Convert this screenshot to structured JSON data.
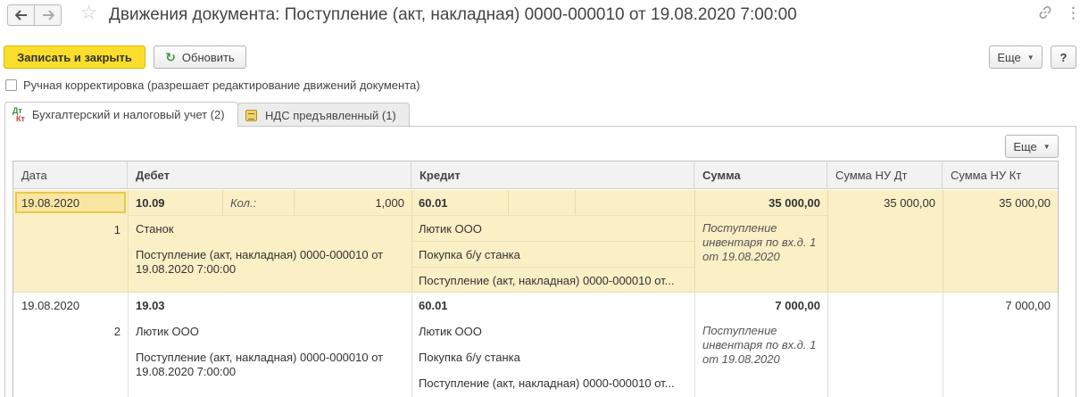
{
  "window": {
    "title": "Движения документа: Поступление (акт, накладная) 0000-000010 от 19.08.2020 7:00:00",
    "icons": [
      "arrow-left-icon",
      "arrow-right-icon",
      "star-icon",
      "link-icon",
      "more-vertical-icon"
    ]
  },
  "toolbar": {
    "save_close_label": "Записать и закрыть",
    "refresh_label": "Обновить",
    "more_label": "Еще",
    "help_label": "?"
  },
  "manual_edit": {
    "label": "Ручная корректировка (разрешает редактирование движений документа)",
    "checked": false
  },
  "tabs": [
    {
      "label": "Бухгалтерский и налоговый учет (2)",
      "icon": "dt-kt-icon",
      "icon_dt": "Дт",
      "icon_kt": "Кт",
      "active": true
    },
    {
      "label": "НДС предъявленный (1)",
      "icon": "register-icon",
      "active": false
    }
  ],
  "table": {
    "more_label": "Еще",
    "columns": [
      "Дата",
      "Дебет",
      "Кредит",
      "Сумма",
      "Сумма НУ Дт",
      "Сумма НУ Кт"
    ],
    "rows": [
      {
        "date": "19.08.2020",
        "number": "1",
        "debit_account": "10.09",
        "qty_label": "Кол.:",
        "qty_value": "1,000",
        "debit_sub1": "Станок",
        "debit_sub2": "Поступление (акт, накладная) 0000-000010 от 19.08.2020 7:00:00",
        "credit_account": "60.01",
        "credit_sub1": "Лютик ООО",
        "credit_sub2": "Покупка б/у станка",
        "credit_sub3": "Поступление (акт, накладная) 0000-000010 от...",
        "amount": "35 000,00",
        "content": "Поступление инвентаря по вх.д. 1 от 19.08.2020",
        "nu_dt": "35 000,00",
        "nu_kt": "35 000,00",
        "selected": true
      },
      {
        "date": "19.08.2020",
        "number": "2",
        "debit_account": "19.03",
        "debit_sub1": "Лютик ООО",
        "debit_sub2": "Поступление (акт, накладная) 0000-000010 от 19.08.2020 7:00:00",
        "credit_account": "60.01",
        "credit_sub1": "Лютик ООО",
        "credit_sub2": "Покупка б/у станка",
        "credit_sub3": "Поступление (акт, накладная) 0000-000010 от...",
        "amount": "7 000,00",
        "content": "Поступление инвентаря по вх.д. 1 от 19.08.2020",
        "nu_dt": "",
        "nu_kt": "7 000,00",
        "selected": false
      }
    ]
  },
  "colors": {
    "primary_button": "#fbde2c",
    "selected_row": "#fbefc6",
    "header_bg": "#f2f2f2"
  }
}
